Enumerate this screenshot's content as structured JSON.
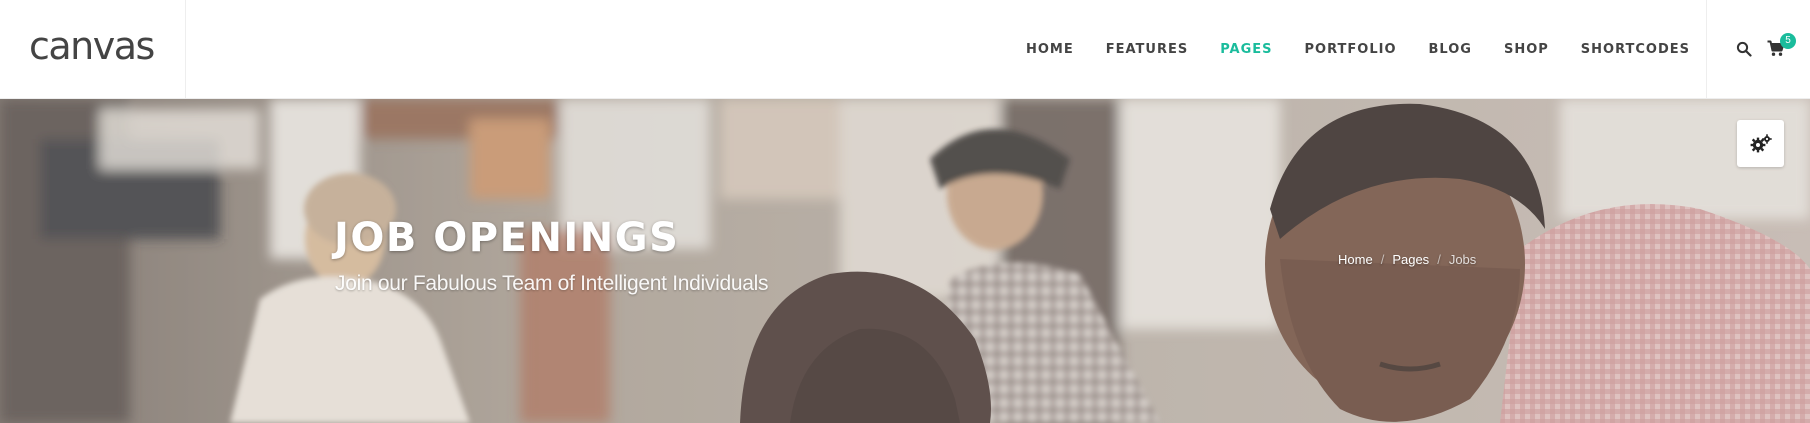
{
  "logo": {
    "text": "canvas"
  },
  "nav": {
    "items": [
      {
        "label": "HOME",
        "active": false
      },
      {
        "label": "FEATURES",
        "active": false
      },
      {
        "label": "PAGES",
        "active": true
      },
      {
        "label": "PORTFOLIO",
        "active": false
      },
      {
        "label": "BLOG",
        "active": false
      },
      {
        "label": "SHOP",
        "active": false
      },
      {
        "label": "SHORTCODES",
        "active": false
      }
    ]
  },
  "tools": {
    "search_icon": "search-icon",
    "cart_icon": "shopping-cart-icon",
    "cart_count": "5"
  },
  "hero": {
    "title": "JOB OPENINGS",
    "subtitle": "Join our Fabulous Team of Intelligent Individuals"
  },
  "breadcrumb": {
    "items": [
      "Home",
      "Pages"
    ],
    "current": "Jobs",
    "separator": "/"
  },
  "settings_button": {
    "icon": "gears-icon"
  },
  "colors": {
    "accent": "#1abc9c",
    "text": "#444444",
    "header_bg": "#ffffff"
  }
}
